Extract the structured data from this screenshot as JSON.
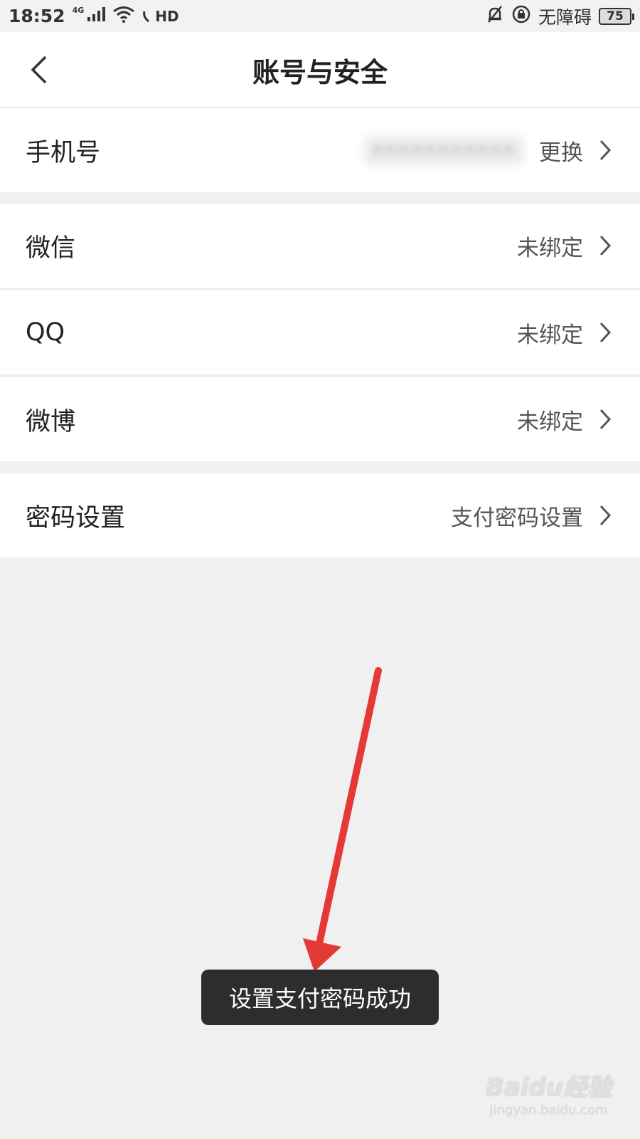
{
  "status_bar": {
    "time": "18:52",
    "network": "4G",
    "hd": "HD",
    "accessibility": "无障碍",
    "battery": "75"
  },
  "header": {
    "title": "账号与安全"
  },
  "rows": {
    "phone": {
      "label": "手机号",
      "action": "更换"
    },
    "wechat": {
      "label": "微信",
      "value": "未绑定"
    },
    "qq": {
      "label": "QQ",
      "value": "未绑定"
    },
    "weibo": {
      "label": "微博",
      "value": "未绑定"
    },
    "password": {
      "label": "密码设置",
      "value": "支付密码设置"
    }
  },
  "toast": {
    "message": "设置支付密码成功"
  },
  "watermark": {
    "main": "Baidu经验",
    "sub": "jingyan.baidu.com"
  },
  "colors": {
    "arrow": "#e53935",
    "toast_bg": "#2d2d2d",
    "page_bg": "#f0f0f0"
  }
}
